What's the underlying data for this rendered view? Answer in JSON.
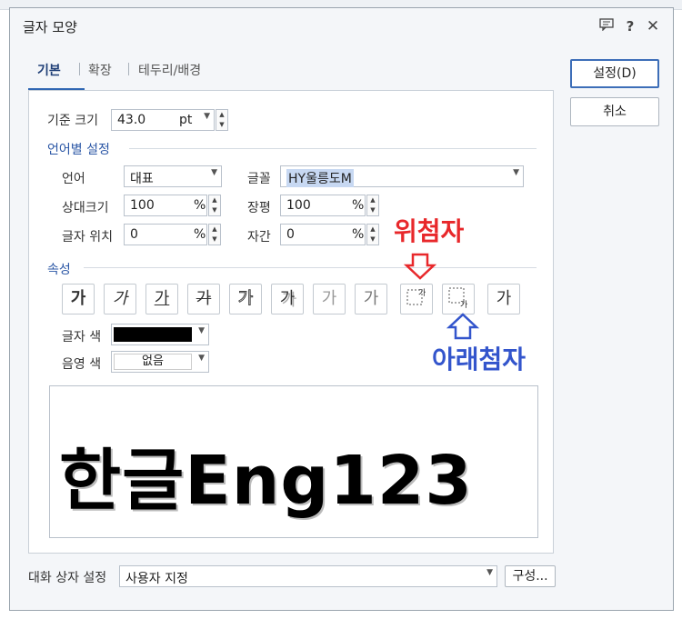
{
  "dialog": {
    "title": "글자 모양",
    "tabs": [
      "기본",
      "확장",
      "테두리/배경"
    ]
  },
  "base_size": {
    "label": "기준 크기",
    "value": "43.0",
    "unit": "pt"
  },
  "lang_section": {
    "title": "언어별 설정",
    "language": {
      "label": "언어",
      "value": "대표"
    },
    "font": {
      "label": "글꼴",
      "value": "HY울릉도M"
    },
    "rel_size": {
      "label": "상대크기",
      "value": "100",
      "unit": "%"
    },
    "width": {
      "label": "장평",
      "value": "100",
      "unit": "%"
    },
    "char_pos": {
      "label": "글자 위치",
      "value": "0",
      "unit": "%"
    },
    "spacing": {
      "label": "자간",
      "value": "0",
      "unit": "%"
    }
  },
  "attributes": {
    "title": "속성",
    "buttons": [
      {
        "name": "bold",
        "glyph": "가"
      },
      {
        "name": "italic",
        "glyph": "가"
      },
      {
        "name": "underline",
        "glyph": "가"
      },
      {
        "name": "strikethrough",
        "glyph": "가"
      },
      {
        "name": "outline",
        "glyph": "가"
      },
      {
        "name": "shadow",
        "glyph": "가"
      },
      {
        "name": "emboss",
        "glyph": "가"
      },
      {
        "name": "engrave",
        "glyph": "가"
      },
      {
        "name": "superscript",
        "glyph": "가"
      },
      {
        "name": "subscript",
        "glyph": "가"
      },
      {
        "name": "normal",
        "glyph": "가"
      }
    ],
    "text_color": {
      "label": "글자 색",
      "color": "#000000"
    },
    "shade_color": {
      "label": "음영 색",
      "value": "없음"
    }
  },
  "preview_text": "한글Eng123",
  "annotations": {
    "superscript": "위첨자",
    "subscript": "아래첨자"
  },
  "side_buttons": {
    "ok": "설정(D)",
    "cancel": "취소"
  },
  "bottom": {
    "label": "대화 상자 설정",
    "value": "사용자 지정",
    "config_button": "구성..."
  },
  "colors": {
    "accent": "#2f66b3",
    "annotation_red": "#e8282b",
    "annotation_blue": "#3355cc"
  }
}
